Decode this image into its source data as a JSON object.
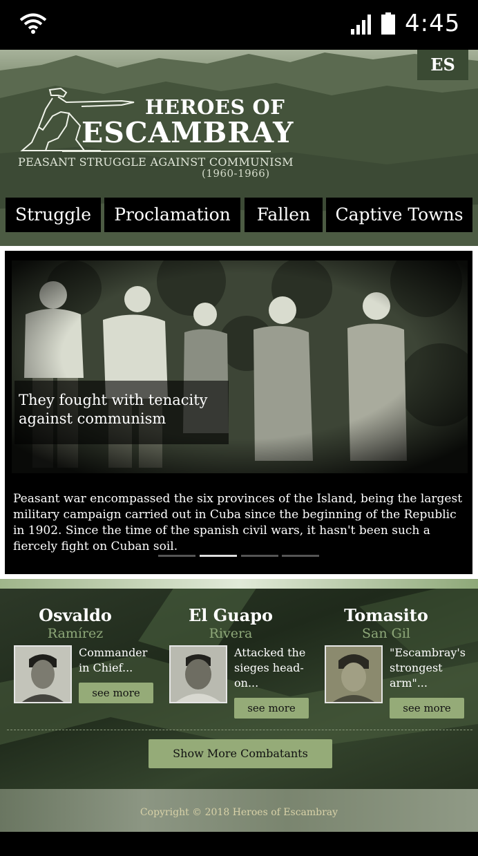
{
  "status_bar": {
    "time": "4:45"
  },
  "header": {
    "lang_button": "ES",
    "logo": {
      "title_line1": "HEROES OF",
      "title_line2": "ESCAMBRAY",
      "subtitle": "PEASANT STRUGGLE AGAINST COMMUNISM",
      "years": "(1960-1966)"
    },
    "nav": [
      {
        "label": "Struggle"
      },
      {
        "label": "Proclamation"
      },
      {
        "label": "Fallen"
      },
      {
        "label": "Captive Towns"
      }
    ]
  },
  "slider": {
    "caption": "They fought with tenacity against communism",
    "text": "Peasant war encompassed the six provinces of the Island, being the largest military campaign carried out in Cuba since the beginning of the Republic in 1902. Since the time of the spanish civil wars, it hasn't been such a fiercely fight on Cuban soil.",
    "dots": 4,
    "active_dot": 2
  },
  "combatants": [
    {
      "first": "Osvaldo",
      "last": "Ramírez",
      "desc": "Commander in Chief...",
      "button": "see more"
    },
    {
      "first": "El Guapo",
      "last": "Rivera",
      "desc": "Attacked the sieges head-on...",
      "button": "see more"
    },
    {
      "first": "Tomasito",
      "last": "San Gil",
      "desc": "\"Escambray's strongest arm\"...",
      "button": "see more"
    }
  ],
  "show_more_label": "Show More Combatants",
  "footer": {
    "copyright": "Copyright © 2018 Heroes of Escambray"
  }
}
